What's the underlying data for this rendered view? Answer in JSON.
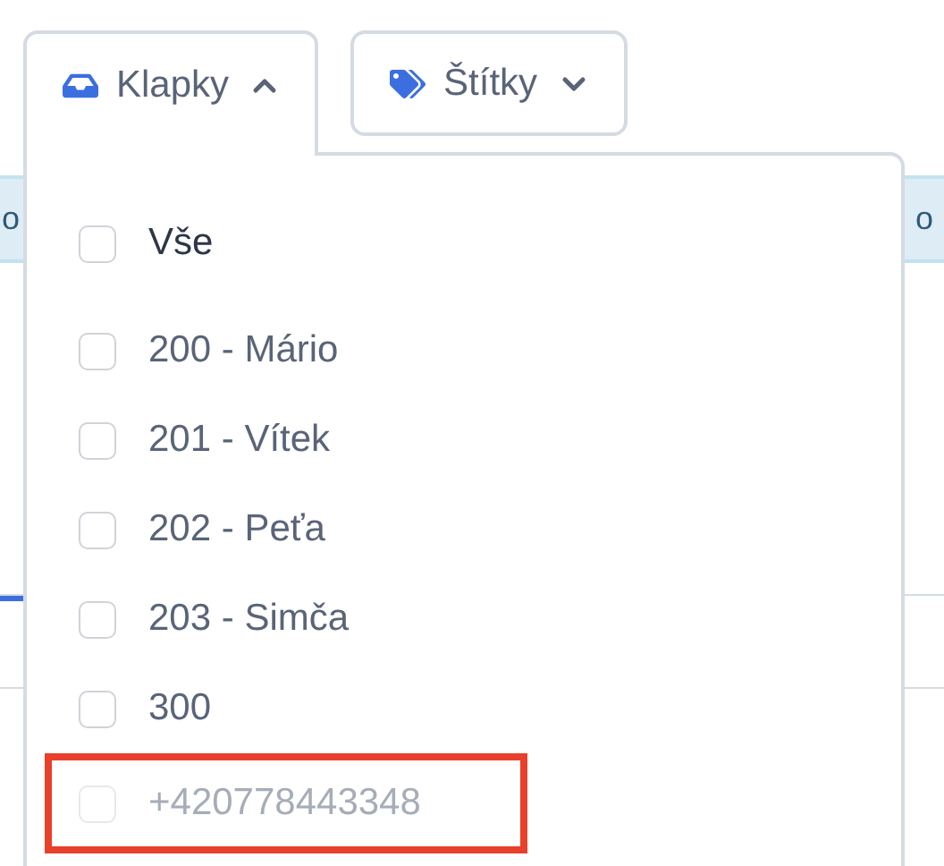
{
  "toolbar": {
    "buttons": [
      {
        "label": "Klapky",
        "kind": "inbox",
        "expanded": true
      },
      {
        "label": "Štítky",
        "kind": "tag",
        "expanded": false
      }
    ]
  },
  "background": {
    "header_left": "o",
    "header_right": "o"
  },
  "dropdown": {
    "items": [
      {
        "label": "Vše",
        "kind": "all",
        "checked": false,
        "disabled": false,
        "highlighted": false
      },
      {
        "label": "200 - Mário",
        "kind": "option",
        "checked": false,
        "disabled": false,
        "highlighted": false
      },
      {
        "label": "201 - Vítek",
        "kind": "option",
        "checked": false,
        "disabled": false,
        "highlighted": false
      },
      {
        "label": "202 - Peťa",
        "kind": "option",
        "checked": false,
        "disabled": false,
        "highlighted": false
      },
      {
        "label": "203 - Simča",
        "kind": "option",
        "checked": false,
        "disabled": false,
        "highlighted": false
      },
      {
        "label": "300",
        "kind": "option",
        "checked": false,
        "disabled": false,
        "highlighted": false
      },
      {
        "label": "+420778443348",
        "kind": "option",
        "checked": false,
        "disabled": true,
        "highlighted": true
      }
    ]
  }
}
